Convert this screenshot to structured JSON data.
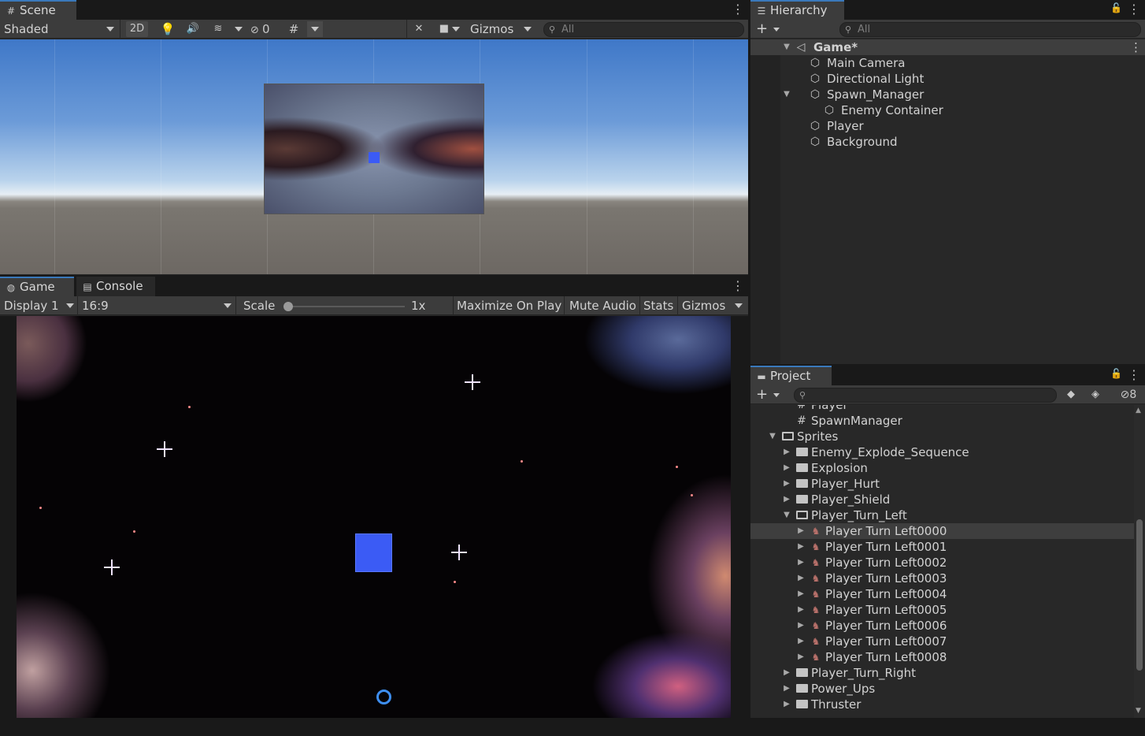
{
  "scene": {
    "tab_label": "Scene",
    "shading": "Shaded",
    "btn_2d": "2D",
    "hidden_count": "0",
    "gizmos": "Gizmos",
    "search_placeholder": "All"
  },
  "game": {
    "tab_label": "Game",
    "console_tab_label": "Console",
    "display": "Display 1",
    "aspect": "16:9",
    "scale_label": "Scale",
    "scale_value": "1x",
    "scale_fraction": 0.0,
    "maximize_on_play": "Maximize On Play",
    "mute_audio": "Mute Audio",
    "stats": "Stats",
    "gizmos": "Gizmos"
  },
  "hierarchy": {
    "tab_label": "Hierarchy",
    "search_placeholder": "All",
    "add_label": "+",
    "root": "Game*",
    "items": [
      {
        "label": "Main Camera",
        "depth": 1,
        "expandable": false,
        "expanded": false
      },
      {
        "label": "Directional Light",
        "depth": 1,
        "expandable": false,
        "expanded": false
      },
      {
        "label": "Spawn_Manager",
        "depth": 1,
        "expandable": true,
        "expanded": true
      },
      {
        "label": "Enemy Container",
        "depth": 2,
        "expandable": false,
        "expanded": false
      },
      {
        "label": "Player",
        "depth": 1,
        "expandable": false,
        "expanded": false
      },
      {
        "label": "Background",
        "depth": 1,
        "expandable": false,
        "expanded": false
      }
    ]
  },
  "project": {
    "tab_label": "Project",
    "add_label": "+",
    "hidden_count": "8",
    "items": [
      {
        "label": "Player",
        "kind": "script",
        "depth": 1
      },
      {
        "label": "SpawnManager",
        "kind": "script",
        "depth": 1
      },
      {
        "label": "Sprites",
        "kind": "folder-open",
        "depth": 0,
        "arrow": "down"
      },
      {
        "label": "Enemy_Explode_Sequence",
        "kind": "folder",
        "depth": 1,
        "arrow": "right"
      },
      {
        "label": "Explosion",
        "kind": "folder",
        "depth": 1,
        "arrow": "right"
      },
      {
        "label": "Player_Hurt",
        "kind": "folder",
        "depth": 1,
        "arrow": "right"
      },
      {
        "label": "Player_Shield",
        "kind": "folder",
        "depth": 1,
        "arrow": "right"
      },
      {
        "label": "Player_Turn_Left",
        "kind": "folder-open",
        "depth": 1,
        "arrow": "down"
      },
      {
        "label": "Player Turn Left0000",
        "kind": "sprite",
        "depth": 2,
        "arrow": "right",
        "selected": true
      },
      {
        "label": "Player Turn Left0001",
        "kind": "sprite",
        "depth": 2,
        "arrow": "right"
      },
      {
        "label": "Player Turn Left0002",
        "kind": "sprite",
        "depth": 2,
        "arrow": "right"
      },
      {
        "label": "Player Turn Left0003",
        "kind": "sprite",
        "depth": 2,
        "arrow": "right"
      },
      {
        "label": "Player Turn Left0004",
        "kind": "sprite",
        "depth": 2,
        "arrow": "right"
      },
      {
        "label": "Player Turn Left0005",
        "kind": "sprite",
        "depth": 2,
        "arrow": "right"
      },
      {
        "label": "Player Turn Left0006",
        "kind": "sprite",
        "depth": 2,
        "arrow": "right"
      },
      {
        "label": "Player Turn Left0007",
        "kind": "sprite",
        "depth": 2,
        "arrow": "right"
      },
      {
        "label": "Player Turn Left0008",
        "kind": "sprite",
        "depth": 2,
        "arrow": "right"
      },
      {
        "label": "Player_Turn_Right",
        "kind": "folder",
        "depth": 1,
        "arrow": "right"
      },
      {
        "label": "Power_Ups",
        "kind": "folder",
        "depth": 1,
        "arrow": "right"
      },
      {
        "label": "Thruster",
        "kind": "folder",
        "depth": 1,
        "arrow": "right"
      }
    ]
  },
  "colors": {
    "accent": "#3a79bb",
    "player": "#3b5bf5",
    "panel": "#282828",
    "toolbar": "#3c3c3c"
  }
}
